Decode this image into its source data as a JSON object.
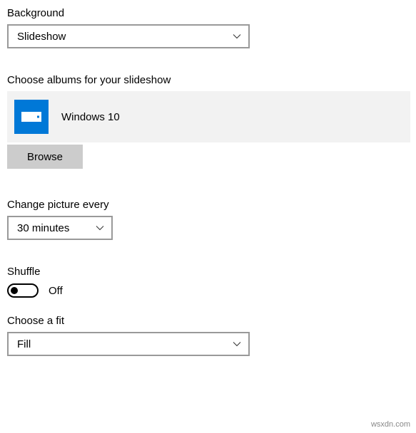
{
  "background": {
    "label": "Background",
    "selected": "Slideshow"
  },
  "albums": {
    "label": "Choose albums for your slideshow",
    "item": {
      "name": "Windows 10",
      "icon": "drive-icon"
    },
    "browse_label": "Browse"
  },
  "change_picture": {
    "label": "Change picture every",
    "selected": "30 minutes"
  },
  "shuffle": {
    "label": "Shuffle",
    "state_label": "Off",
    "value": false
  },
  "fit": {
    "label": "Choose a fit",
    "selected": "Fill"
  },
  "watermark": "wsxdn.com"
}
